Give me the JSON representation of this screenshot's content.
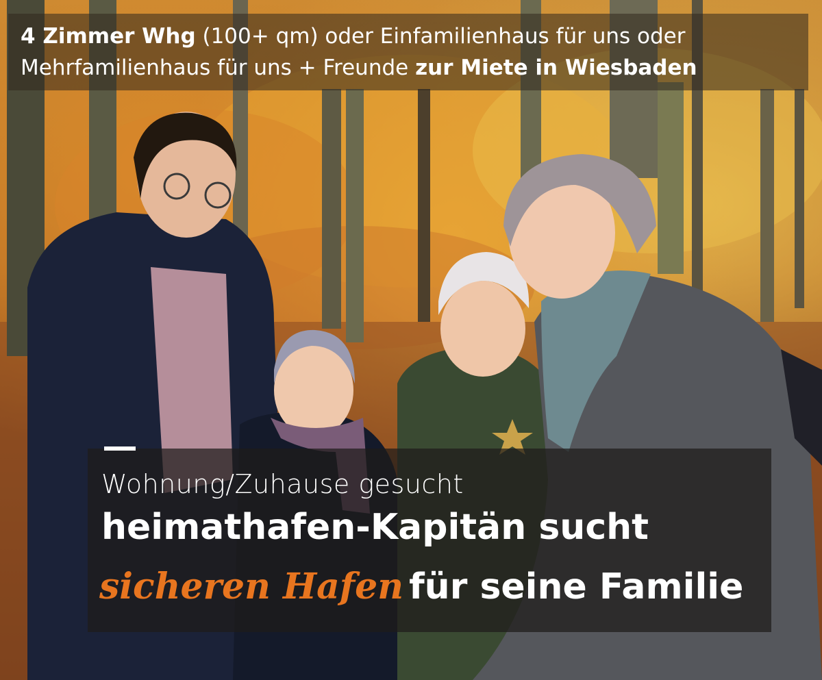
{
  "top": {
    "line1_bold": "4 Zimmer Whg",
    "line1_rest": " (100+ qm) oder Einfamilienhaus für uns oder",
    "line2_rest": "Mehrfamilienhaus für uns + Freunde ",
    "line2_bold": "zur Miete in Wiesbaden"
  },
  "bottom": {
    "subtitle": "Wohnung/Zuhause gesucht",
    "headline_line1": "heimathafen-Kapitän sucht",
    "headline_accent": "sicheren Hafen",
    "headline_line2_rest": "für seine Familie"
  },
  "colors": {
    "accent": "#e8751f",
    "overlay": "#1e1c1a",
    "text": "#ffffff"
  }
}
